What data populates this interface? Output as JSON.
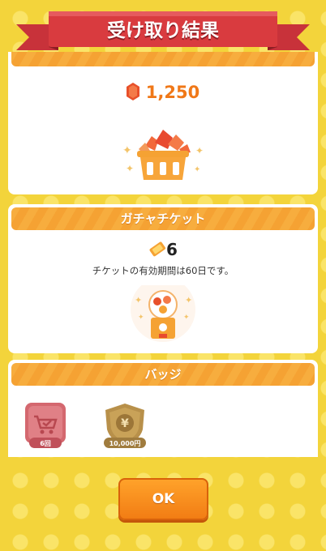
{
  "header": {
    "title": "受け取り結果"
  },
  "rupee_section": {
    "amount": "1,250"
  },
  "ticket_section": {
    "title": "ガチャチケット",
    "count": "6",
    "note": "チケットの有効期間は60日です。"
  },
  "badge_section": {
    "title": "バッジ",
    "badges": [
      {
        "label": "6回",
        "icon": "cart-check-icon",
        "color": "#d4686f"
      },
      {
        "label": "10,000円",
        "icon": "yen-shield-icon",
        "color": "#b8904a"
      }
    ]
  },
  "footer": {
    "ok_label": "OK"
  },
  "colors": {
    "accent": "#f5a233",
    "banner": "#d93b3f",
    "background": "#f3d43b"
  }
}
